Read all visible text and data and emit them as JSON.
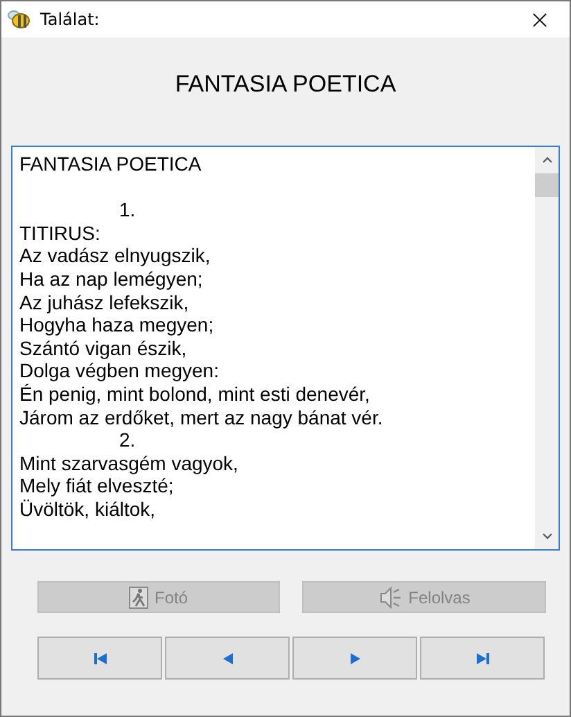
{
  "window": {
    "title": "Találat:"
  },
  "heading": "FANTASIA POETICA",
  "text_lines": [
    {
      "kind": "line",
      "text": "FANTASIA POETICA"
    },
    {
      "kind": "blank"
    },
    {
      "kind": "number",
      "text": "1."
    },
    {
      "kind": "line",
      "text": "TITIRUS:"
    },
    {
      "kind": "line",
      "text": "Az vadász elnyugszik,"
    },
    {
      "kind": "line",
      "text": "Ha az nap lemégyen;"
    },
    {
      "kind": "line",
      "text": "Az juhász lefekszik,"
    },
    {
      "kind": "line",
      "text": "Hogyha haza megyen;"
    },
    {
      "kind": "line",
      "text": "Szántó vigan észik,"
    },
    {
      "kind": "line",
      "text": "Dolga végben megyen:"
    },
    {
      "kind": "line",
      "text": "Én penig, mint bolond, mint esti denevér,"
    },
    {
      "kind": "line",
      "text": "Járom az erdőket, mert az nagy bánat vér."
    },
    {
      "kind": "number",
      "text": "2."
    },
    {
      "kind": "line",
      "text": "Mint szarvasgém vagyok,"
    },
    {
      "kind": "line",
      "text": "Mely fiát elveszté;"
    },
    {
      "kind": "line",
      "text": "Üvöltök, kiáltok,"
    }
  ],
  "action_buttons": [
    {
      "kind": "photo",
      "label": "Fotó",
      "disabled": true
    },
    {
      "kind": "read",
      "label": "Felolvas",
      "disabled": true
    }
  ],
  "nav_buttons": [
    {
      "kind": "first"
    },
    {
      "kind": "previous"
    },
    {
      "kind": "next"
    },
    {
      "kind": "last"
    }
  ]
}
